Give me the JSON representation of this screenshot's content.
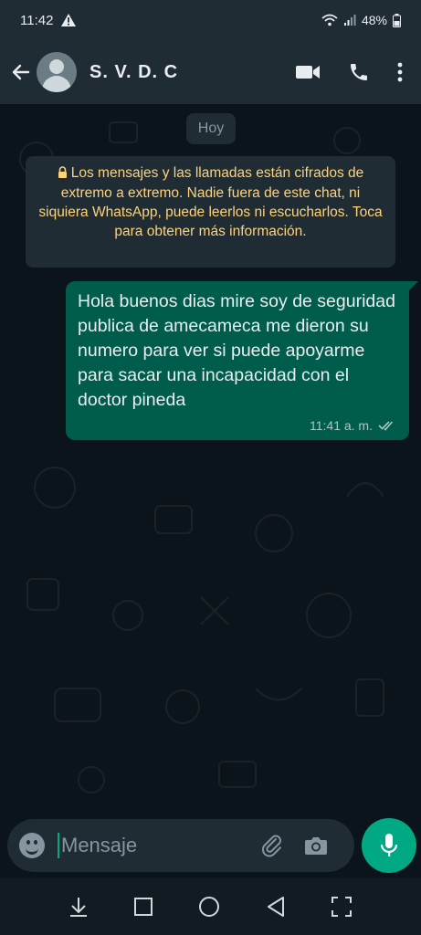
{
  "status_bar": {
    "time": "11:42",
    "battery": "48%"
  },
  "header": {
    "contact_name": "S. V. D. C"
  },
  "chat": {
    "day_label": "Hoy",
    "encryption_notice": "Los mensajes y las llamadas están cifrados de extremo a extremo. Nadie fuera de este chat, ni siquiera WhatsApp, puede leerlos ni escucharlos. Toca para obtener más información.",
    "messages": [
      {
        "text": "Hola buenos dias mire soy de seguridad publica de amecameca me dieron su numero para ver si puede apoyarme para sacar una incapacidad con el doctor pineda",
        "time": "11:41 a. m."
      }
    ]
  },
  "composer": {
    "placeholder": "Mensaje"
  },
  "colors": {
    "accent": "#00a884",
    "outgoing_bubble": "#005c4b",
    "header_bg": "#1f2c34",
    "chat_bg": "#0b141a",
    "encryption_text": "#ffd279"
  },
  "icons": [
    "warning-icon",
    "wifi-icon",
    "signal-icon",
    "battery-icon",
    "back-arrow-icon",
    "video-call-icon",
    "phone-icon",
    "more-vert-icon",
    "lock-icon",
    "double-check-icon",
    "emoji-icon",
    "attach-icon",
    "camera-icon",
    "mic-icon",
    "nav-down-icon",
    "nav-recents-icon",
    "nav-home-icon",
    "nav-back-icon",
    "screenshot-icon"
  ]
}
